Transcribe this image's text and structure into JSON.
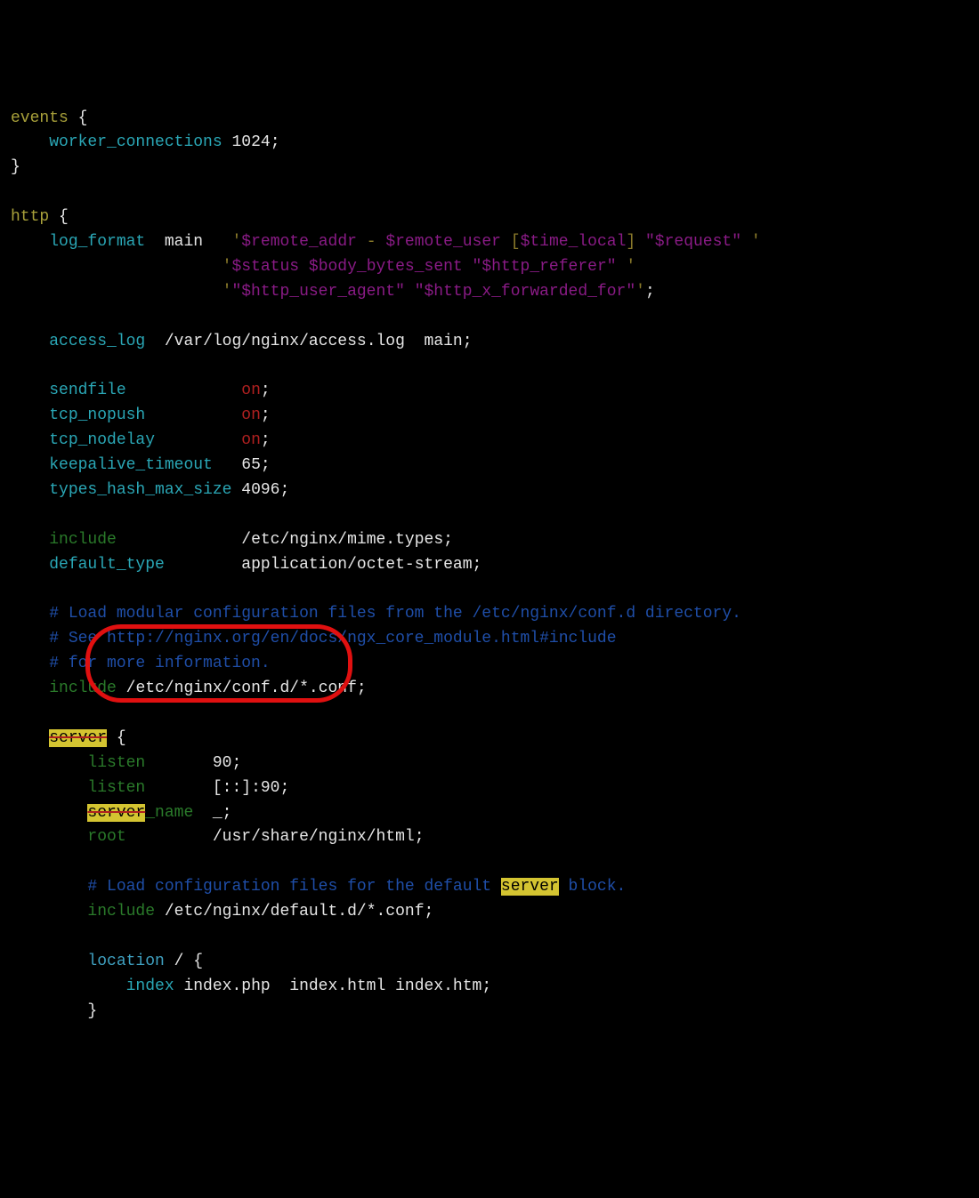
{
  "tokens": {
    "events": "events",
    "worker_connections": "worker_connections",
    "wc_val": "1024",
    "http": "http",
    "log_format": "log_format",
    "main": "main",
    "lf1_a": "$remote_addr",
    "lf1_dash": " - ",
    "lf1_b": "$remote_user",
    "lf1_br1": " [",
    "lf1_c": "$time_local",
    "lf1_br2": "] ",
    "lf1_d": "\"$request\"",
    "lf2_a": "$status",
    "lf2_sp": " ",
    "lf2_b": "$body_bytes_sent",
    "lf2_c": " \"$http_referer\"",
    "lf3_a": "\"$http_user_agent\"",
    "lf3_sp": " ",
    "lf3_b": "\"$http_x_forwarded_for\"",
    "access_log": "access_log",
    "access_log_path": "/var/log/nginx/access.log",
    "access_log_main": "main",
    "sendfile": "sendfile",
    "tcp_nopush": "tcp_nopush",
    "tcp_nodelay": "tcp_nodelay",
    "on": "on",
    "keepalive_timeout": "keepalive_timeout",
    "keepalive_val": "65",
    "types_hash": "types_hash_max_size",
    "types_hash_val": "4096",
    "include": "include",
    "mime_types": "/etc/nginx/mime.types",
    "default_type": "default_type",
    "default_type_val": "application/octet-stream",
    "c1": "# Load modular configuration files from the /etc/nginx/conf.d directory.",
    "c2": "# See http://nginx.org/en/docs/ngx_core_module.html#include",
    "c3": "# for more information.",
    "confd": "/etc/nginx/conf.d/*.conf",
    "server_hl": "server",
    "listen": "listen",
    "listen90": "90",
    "listen6": "[::]:90",
    "server_name_hl": "server",
    "server_name_rest": "_name",
    "server_name_val": "_",
    "root": "root",
    "root_val": "/usr/share/nginx/html",
    "c4a": "# Load configuration files for the default ",
    "c4b": "server",
    "c4c": " block.",
    "defaultd": "/etc/nginx/default.d/*.conf",
    "location": "location",
    "location_match": "/",
    "index": "index",
    "index_val": "index.php  index.html index.htm"
  }
}
